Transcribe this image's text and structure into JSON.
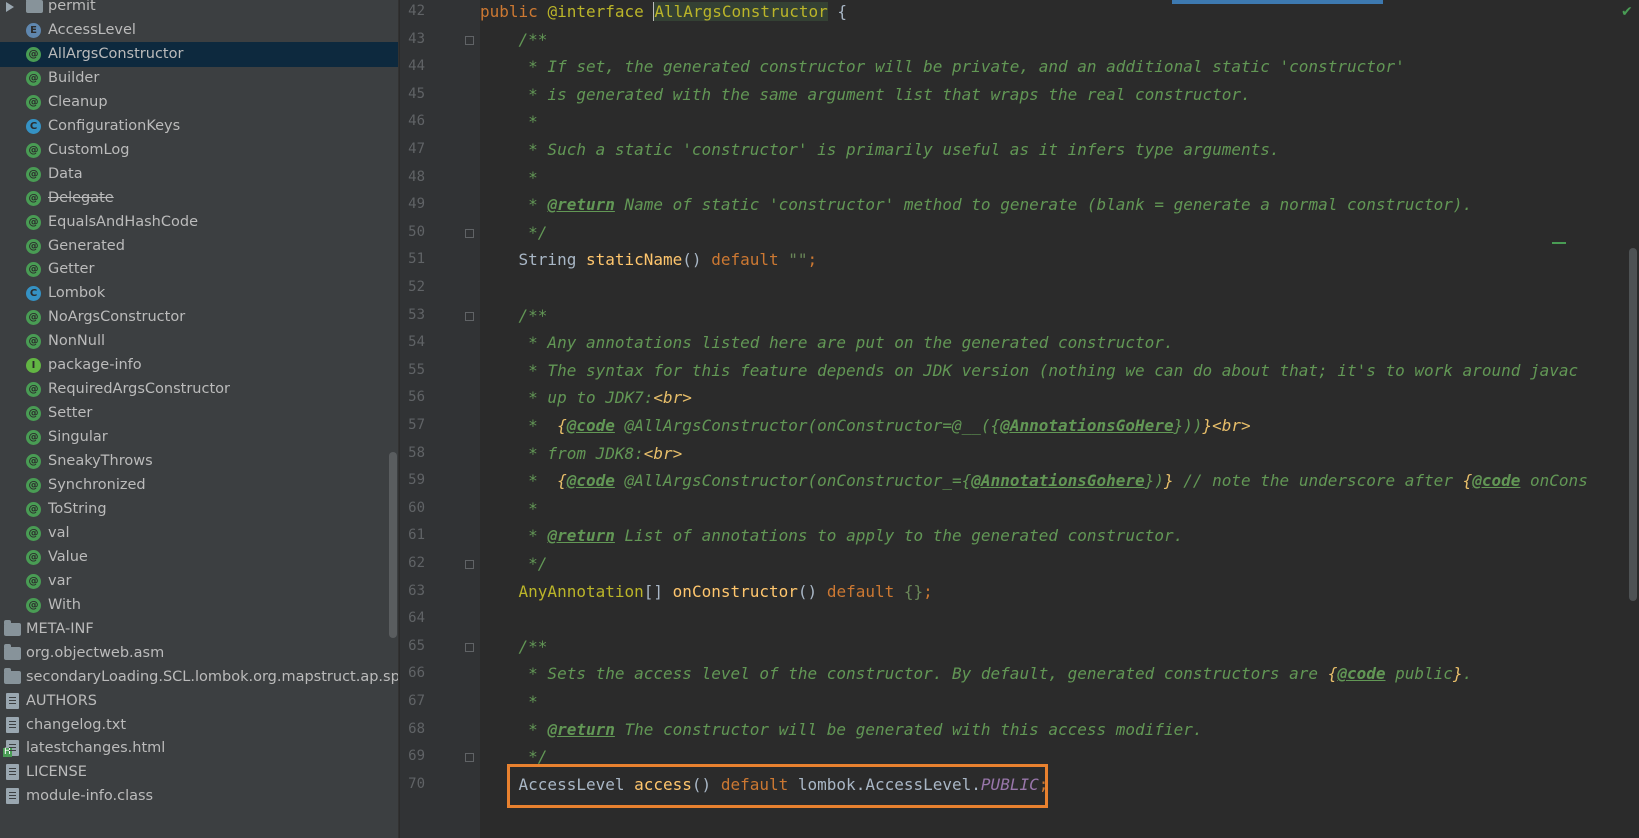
{
  "tree_items": [
    {
      "name": "permit",
      "icon": "folder-icon",
      "type": "folder",
      "expand": true
    },
    {
      "name": "AccessLevel",
      "icon": "enum-icon",
      "type": "enum"
    },
    {
      "name": "AllArgsConstructor",
      "icon": "annotation-icon",
      "type": "annotation",
      "selected": true
    },
    {
      "name": "Builder",
      "icon": "annotation-icon",
      "type": "annotation"
    },
    {
      "name": "Cleanup",
      "icon": "annotation-icon",
      "type": "annotation"
    },
    {
      "name": "ConfigurationKeys",
      "icon": "class-icon",
      "type": "class"
    },
    {
      "name": "CustomLog",
      "icon": "annotation-icon",
      "type": "annotation"
    },
    {
      "name": "Data",
      "icon": "annotation-icon",
      "type": "annotation"
    },
    {
      "name": "Delegate",
      "icon": "annotation-icon",
      "type": "annotation",
      "strikethrough": true
    },
    {
      "name": "EqualsAndHashCode",
      "icon": "annotation-icon",
      "type": "annotation"
    },
    {
      "name": "Generated",
      "icon": "annotation-icon",
      "type": "annotation"
    },
    {
      "name": "Getter",
      "icon": "annotation-icon",
      "type": "annotation"
    },
    {
      "name": "Lombok",
      "icon": "class-icon",
      "type": "class"
    },
    {
      "name": "NoArgsConstructor",
      "icon": "annotation-icon",
      "type": "annotation"
    },
    {
      "name": "NonNull",
      "icon": "annotation-icon",
      "type": "annotation"
    },
    {
      "name": "package-info",
      "icon": "interface-icon",
      "type": "interface"
    },
    {
      "name": "RequiredArgsConstructor",
      "icon": "annotation-icon",
      "type": "annotation"
    },
    {
      "name": "Setter",
      "icon": "annotation-icon",
      "type": "annotation"
    },
    {
      "name": "Singular",
      "icon": "annotation-icon",
      "type": "annotation"
    },
    {
      "name": "SneakyThrows",
      "icon": "annotation-icon",
      "type": "annotation"
    },
    {
      "name": "Synchronized",
      "icon": "annotation-icon",
      "type": "annotation"
    },
    {
      "name": "ToString",
      "icon": "annotation-icon",
      "type": "annotation"
    },
    {
      "name": "val",
      "icon": "annotation-icon",
      "type": "annotation"
    },
    {
      "name": "Value",
      "icon": "annotation-icon",
      "type": "annotation"
    },
    {
      "name": "var",
      "icon": "annotation-icon",
      "type": "annotation"
    },
    {
      "name": "With",
      "icon": "annotation-icon",
      "type": "annotation"
    },
    {
      "name": "META-INF",
      "icon": "folder-icon",
      "type": "folder",
      "top": true
    },
    {
      "name": "org.objectweb.asm",
      "icon": "folder-icon",
      "type": "folder",
      "top": true
    },
    {
      "name": "secondaryLoading.SCL.lombok.org.mapstruct.ap.spi",
      "icon": "folder-icon",
      "type": "folder",
      "top": true
    },
    {
      "name": "AUTHORS",
      "icon": "file-icon",
      "type": "file",
      "top": true
    },
    {
      "name": "changelog.txt",
      "icon": "file-icon",
      "type": "file",
      "top": true
    },
    {
      "name": "latestchanges.html",
      "icon": "html-file-icon",
      "type": "html",
      "top": true
    },
    {
      "name": "LICENSE",
      "icon": "file-icon",
      "type": "file",
      "top": true
    },
    {
      "name": "module-info.class",
      "icon": "file-icon",
      "type": "file",
      "top": true
    }
  ],
  "editor": {
    "lines": [
      {
        "n": "42",
        "fold": false,
        "segs": [
          [
            "kw",
            "public "
          ],
          [
            "ann",
            "@interface "
          ],
          [
            "pl",
            ""
          ],
          [
            "ann hl-bg",
            "AllArgsConstructor"
          ],
          [
            "pl",
            " {"
          ]
        ],
        "caret": true
      },
      {
        "n": "43",
        "fold": true,
        "segs": [
          [
            "doc",
            "    /**"
          ]
        ]
      },
      {
        "n": "44",
        "fold": false,
        "segs": [
          [
            "doc",
            "     * If set, the generated constructor will be private, and an additional static 'constructor'"
          ]
        ]
      },
      {
        "n": "45",
        "fold": false,
        "segs": [
          [
            "doc",
            "     * is generated with the same argument list that wraps the real constructor."
          ]
        ]
      },
      {
        "n": "46",
        "fold": false,
        "segs": [
          [
            "doc",
            "     *"
          ]
        ]
      },
      {
        "n": "47",
        "fold": false,
        "segs": [
          [
            "doc",
            "     * Such a static 'constructor' is primarily useful as it infers type arguments."
          ]
        ]
      },
      {
        "n": "48",
        "fold": false,
        "segs": [
          [
            "doc",
            "     *"
          ]
        ]
      },
      {
        "n": "49",
        "fold": false,
        "segs": [
          [
            "doc",
            "     * "
          ],
          [
            "dtag",
            "@return"
          ],
          [
            "doc",
            " Name of static 'constructor' method to generate (blank = generate a normal constructor)."
          ]
        ]
      },
      {
        "n": "50",
        "fold": true,
        "segs": [
          [
            "doc",
            "     */"
          ]
        ]
      },
      {
        "n": "51",
        "fold": false,
        "segs": [
          [
            "pl",
            "    String "
          ],
          [
            "fn",
            "staticName"
          ],
          [
            "pl",
            "() "
          ],
          [
            "kw",
            "default "
          ],
          [
            "str",
            "\"\""
          ],
          [
            "kw",
            ";"
          ]
        ]
      },
      {
        "n": "52",
        "fold": false,
        "segs": []
      },
      {
        "n": "53",
        "fold": true,
        "segs": [
          [
            "doc",
            "    /**"
          ]
        ]
      },
      {
        "n": "54",
        "fold": false,
        "segs": [
          [
            "doc",
            "     * Any annotations listed here are put on the generated constructor."
          ]
        ]
      },
      {
        "n": "55",
        "fold": false,
        "segs": [
          [
            "doc",
            "     * The syntax for this feature depends on JDK version (nothing we can do about that; it's to work around javac"
          ]
        ]
      },
      {
        "n": "56",
        "fold": false,
        "segs": [
          [
            "doc",
            "     * up to JDK7:"
          ],
          [
            "html-t",
            "<br>"
          ]
        ]
      },
      {
        "n": "57",
        "fold": false,
        "segs": [
          [
            "doc",
            "     *  "
          ],
          [
            "brace",
            "{"
          ],
          [
            "dtag",
            "@code"
          ],
          [
            "doc",
            " @AllArgsConstructor(onConstructor=@__({"
          ],
          [
            "dtag",
            "@AnnotationsGoHere"
          ],
          [
            "doc",
            "}))"
          ],
          [
            "brace",
            "}"
          ],
          [
            "html-t",
            "<br>"
          ]
        ]
      },
      {
        "n": "58",
        "fold": false,
        "segs": [
          [
            "doc",
            "     * from JDK8:"
          ],
          [
            "html-t",
            "<br>"
          ]
        ]
      },
      {
        "n": "59",
        "fold": false,
        "segs": [
          [
            "doc",
            "     *  "
          ],
          [
            "brace",
            "{"
          ],
          [
            "dtag",
            "@code"
          ],
          [
            "doc",
            " @AllArgsConstructor(onConstructor_={"
          ],
          [
            "dtag",
            "@AnnotationsGohere"
          ],
          [
            "doc",
            "})"
          ],
          [
            "brace",
            "}"
          ],
          [
            "doc",
            " // note the underscore after "
          ],
          [
            "brace",
            "{"
          ],
          [
            "dtag",
            "@code"
          ],
          [
            "doc",
            " onCons"
          ]
        ]
      },
      {
        "n": "60",
        "fold": false,
        "segs": [
          [
            "doc",
            "     *"
          ]
        ]
      },
      {
        "n": "61",
        "fold": false,
        "segs": [
          [
            "doc",
            "     * "
          ],
          [
            "dtag",
            "@return"
          ],
          [
            "doc",
            " List of annotations to apply to the generated constructor."
          ]
        ]
      },
      {
        "n": "62",
        "fold": true,
        "segs": [
          [
            "doc",
            "     */"
          ]
        ]
      },
      {
        "n": "63",
        "fold": false,
        "segs": [
          [
            "ann",
            "    AnyAnnotation"
          ],
          [
            "pl",
            "[] "
          ],
          [
            "fn",
            "onConstructor"
          ],
          [
            "pl",
            "() "
          ],
          [
            "kw",
            "default "
          ],
          [
            "str",
            "{}"
          ],
          [
            "kw",
            ";"
          ]
        ]
      },
      {
        "n": "64",
        "fold": false,
        "segs": []
      },
      {
        "n": "65",
        "fold": true,
        "segs": [
          [
            "doc",
            "    /**"
          ]
        ]
      },
      {
        "n": "66",
        "fold": false,
        "segs": [
          [
            "doc",
            "     * Sets the access level of the constructor. By default, generated constructors are "
          ],
          [
            "brace",
            "{"
          ],
          [
            "dtag",
            "@code"
          ],
          [
            "doc",
            " public"
          ],
          [
            "brace",
            "}"
          ],
          [
            "doc",
            "."
          ]
        ]
      },
      {
        "n": "67",
        "fold": false,
        "segs": [
          [
            "doc",
            "     *"
          ]
        ]
      },
      {
        "n": "68",
        "fold": false,
        "segs": [
          [
            "doc",
            "     * "
          ],
          [
            "dtag",
            "@return"
          ],
          [
            "doc",
            " The constructor will be generated with this access modifier."
          ]
        ]
      },
      {
        "n": "69",
        "fold": true,
        "segs": [
          [
            "doc",
            "     */"
          ]
        ]
      },
      {
        "n": "70",
        "fold": false,
        "segs": [
          [
            "pl",
            "    AccessLevel "
          ],
          [
            "fn",
            "access"
          ],
          [
            "pl",
            "() "
          ],
          [
            "kw",
            "default "
          ],
          [
            "pl",
            "lombok.AccessLevel."
          ],
          [
            "cst",
            "PUBLIC"
          ],
          [
            "kw",
            ";"
          ]
        ],
        "boxed": true
      }
    ]
  },
  "colors": {
    "highlight_box": "#e8812f",
    "selection": "#0d293e",
    "panel": "#3c3f41",
    "editor_bg": "#2b2b2b"
  }
}
